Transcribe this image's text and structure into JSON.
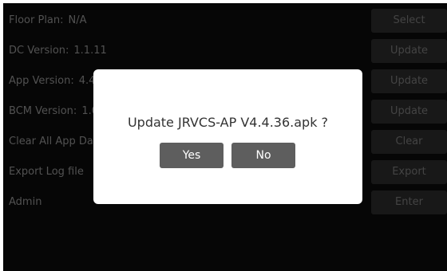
{
  "settings": {
    "rows": [
      {
        "label": "Floor Plan:",
        "value": "N/A",
        "button": "Select"
      },
      {
        "label": "DC Version:",
        "value": "1.1.11",
        "button": "Update"
      },
      {
        "label": "App Version:",
        "value": "4.4",
        "button": "Update"
      },
      {
        "label": "BCM Version:",
        "value": "1.0",
        "button": "Update"
      },
      {
        "label": "Clear All App Data",
        "value": "",
        "button": "Clear"
      },
      {
        "label": "Export Log file",
        "value": "",
        "button": "Export"
      },
      {
        "label": "Admin",
        "value": "",
        "button": "Enter"
      }
    ]
  },
  "dialog": {
    "message": "Update JRVCS-AP V4.4.36.apk ?",
    "yes_label": "Yes",
    "no_label": "No"
  },
  "colors": {
    "screen_background": "#070707",
    "row_button_background": "#1b1b1b",
    "dialog_background": "#ffffff",
    "dialog_button_background": "#5e5e5e"
  }
}
